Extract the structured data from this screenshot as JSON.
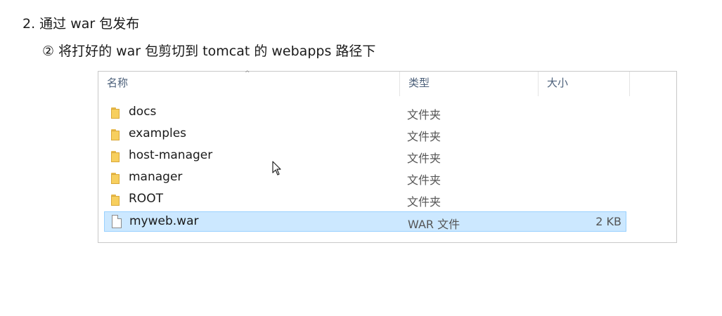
{
  "heading": "2. 通过 war 包发布",
  "subheading": "② 将打好的 war 包剪切到 tomcat 的 webapps 路径下",
  "explorer": {
    "columns": {
      "name": "名称",
      "type": "类型",
      "size": "大小"
    },
    "sort_caret": "^",
    "rows": [
      {
        "name": "docs",
        "type": "文件夹",
        "size": "",
        "icon": "folder-icon"
      },
      {
        "name": "examples",
        "type": "文件夹",
        "size": "",
        "icon": "folder-icon"
      },
      {
        "name": "host-manager",
        "type": "文件夹",
        "size": "",
        "icon": "folder-icon"
      },
      {
        "name": "manager",
        "type": "文件夹",
        "size": "",
        "icon": "folder-icon"
      },
      {
        "name": "ROOT",
        "type": "文件夹",
        "size": "",
        "icon": "folder-icon"
      },
      {
        "name": "myweb.war",
        "type": "WAR 文件",
        "size": "2 KB",
        "icon": "file-icon",
        "selected": true
      }
    ]
  },
  "colors": {
    "selection": "#cce8ff",
    "selection_border": "#99d1ff",
    "folder": "#f7cf5e",
    "header_text": "#4c607a"
  }
}
